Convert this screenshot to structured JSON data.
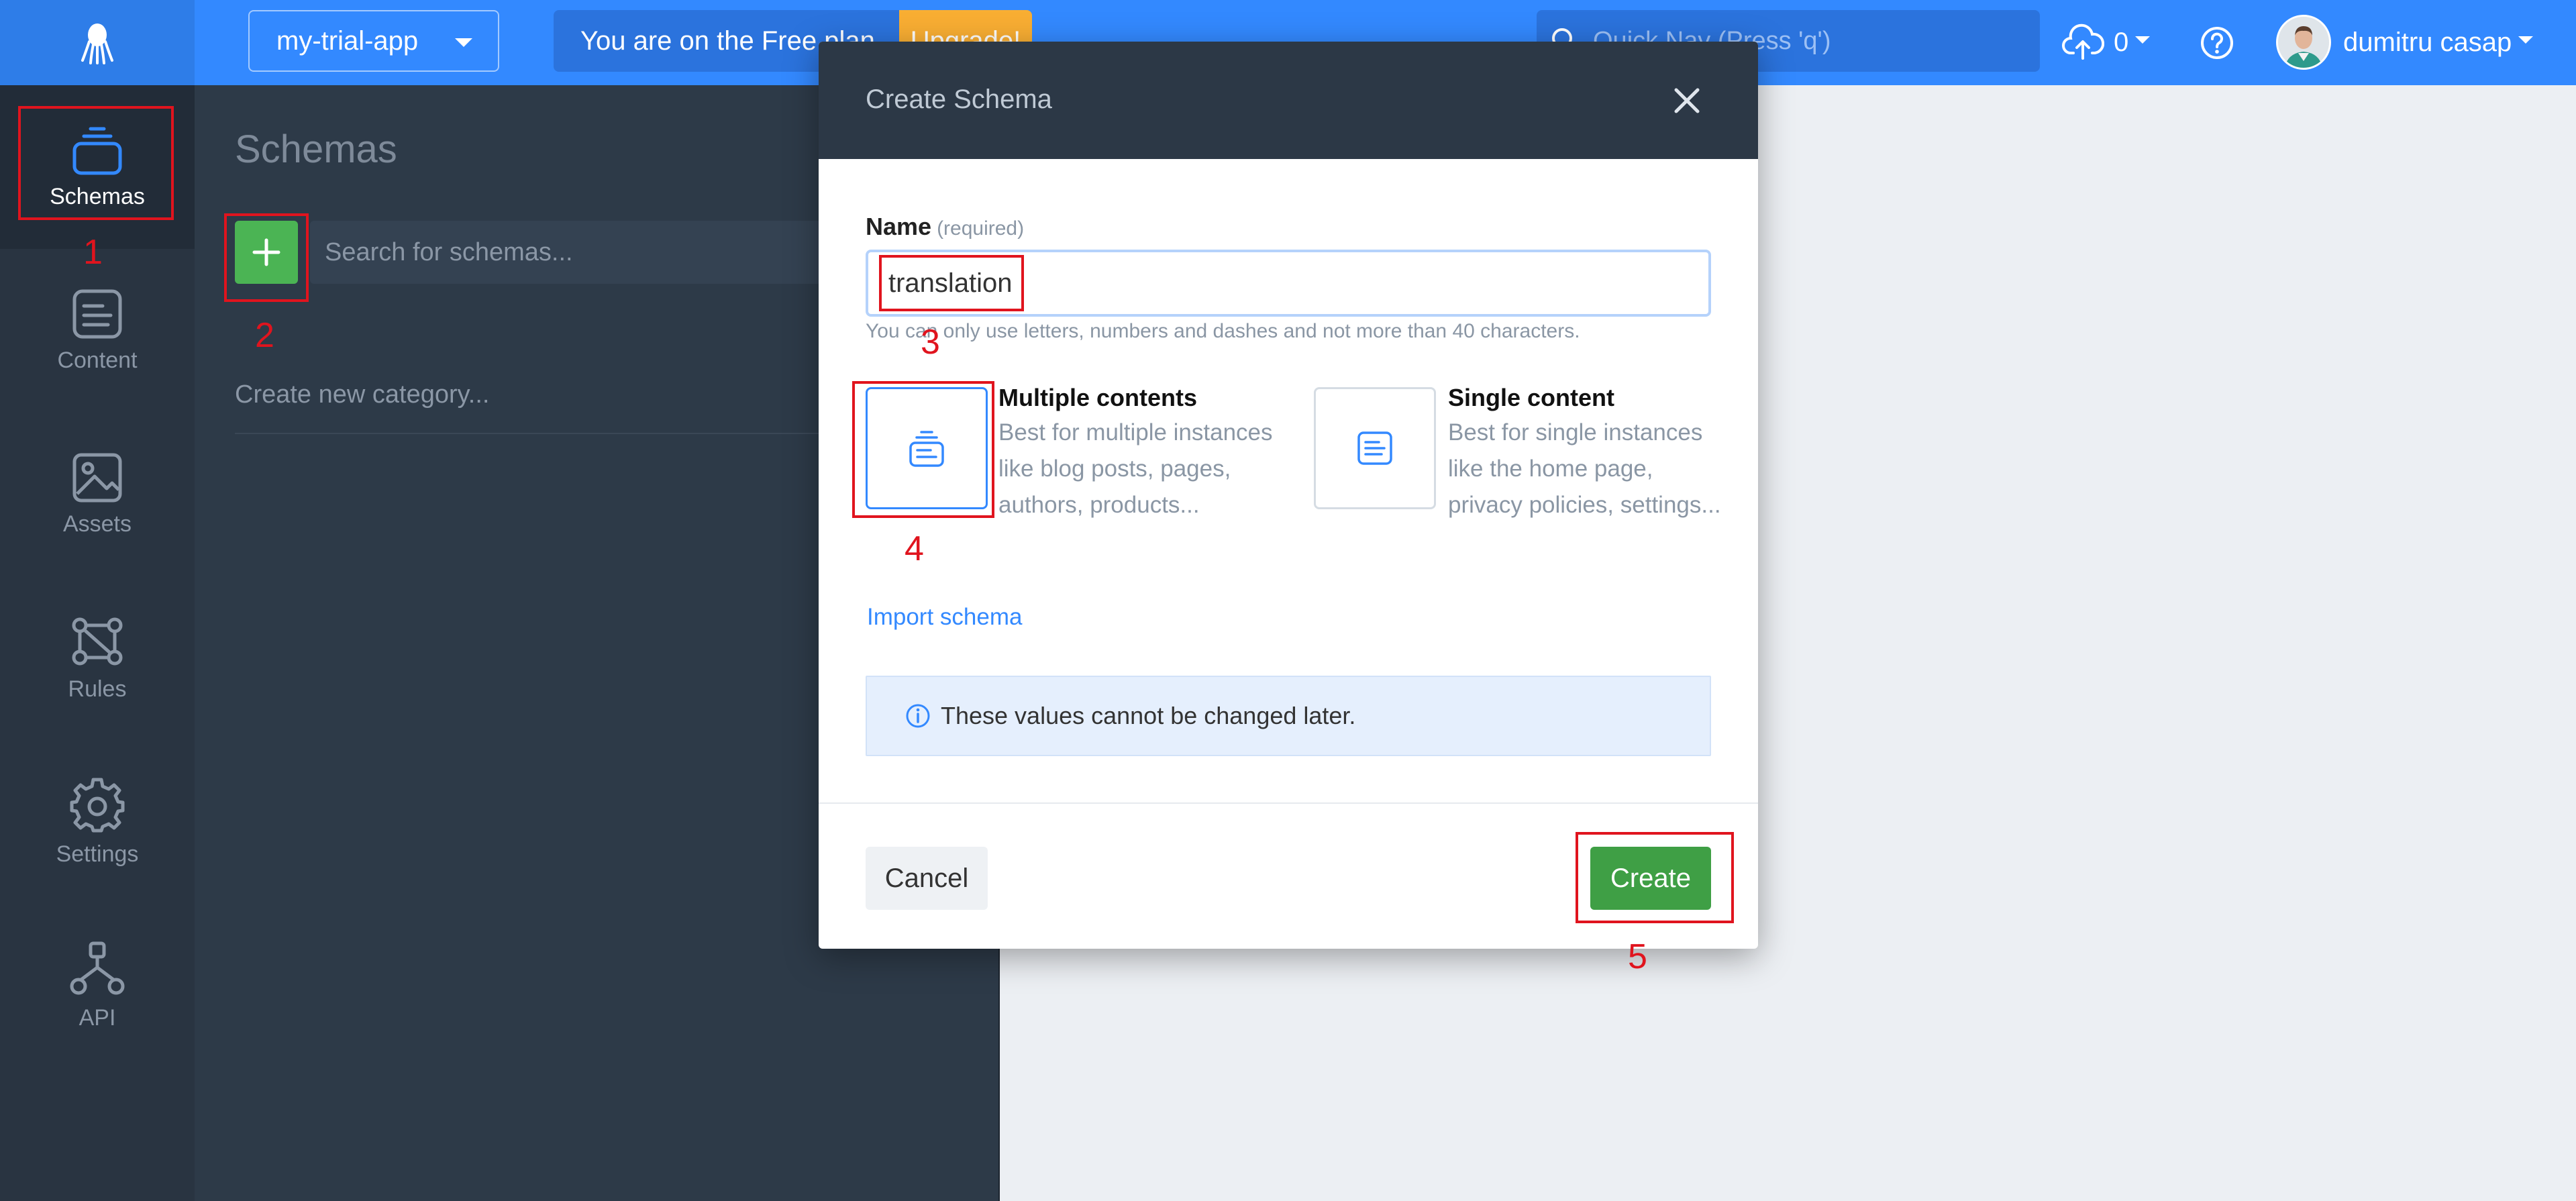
{
  "topbar": {
    "app_name": "my-trial-app",
    "plan_text": "You are on the Free plan.",
    "upgrade_label": "Upgrade!",
    "quicknav_placeholder": "Quick Nav (Press 'q')",
    "upload_count": "0",
    "user_name": "dumitru casap"
  },
  "sidebar": {
    "items": [
      {
        "label": "Schemas",
        "icon": "schemas-icon",
        "active": true
      },
      {
        "label": "Content",
        "icon": "content-icon",
        "active": false
      },
      {
        "label": "Assets",
        "icon": "assets-icon",
        "active": false
      },
      {
        "label": "Rules",
        "icon": "rules-icon",
        "active": false
      },
      {
        "label": "Settings",
        "icon": "gear-icon",
        "active": false
      },
      {
        "label": "API",
        "icon": "api-icon",
        "active": false
      }
    ]
  },
  "schemas_panel": {
    "title": "Schemas",
    "search_placeholder": "Search for schemas...",
    "new_category_placeholder": "Create new category..."
  },
  "modal": {
    "title": "Create Schema",
    "name_label": "Name",
    "name_required": "(required)",
    "name_value": "translation",
    "name_hint": "You can only use letters, numbers and dashes and not more than 40 characters.",
    "types": [
      {
        "title": "Multiple contents",
        "description": "Best for multiple instances like blog posts, pages, authors, products...",
        "selected": true
      },
      {
        "title": "Single content",
        "description": "Best for single instances like the home page, privacy policies, settings...",
        "selected": false
      }
    ],
    "import_label": "Import schema",
    "info_text": "These values cannot be changed later.",
    "cancel_label": "Cancel",
    "create_label": "Create"
  },
  "annotations": [
    "1",
    "2",
    "3",
    "4",
    "5"
  ],
  "colors": {
    "accent": "#3389ff",
    "topbar": "#3389ff",
    "sidebar": "#293441",
    "panel": "#2d3a48",
    "create_button": "#3f9f45",
    "add_button": "#4bb454",
    "upgrade": "#f9ae33",
    "annotation": "#e0141e"
  }
}
